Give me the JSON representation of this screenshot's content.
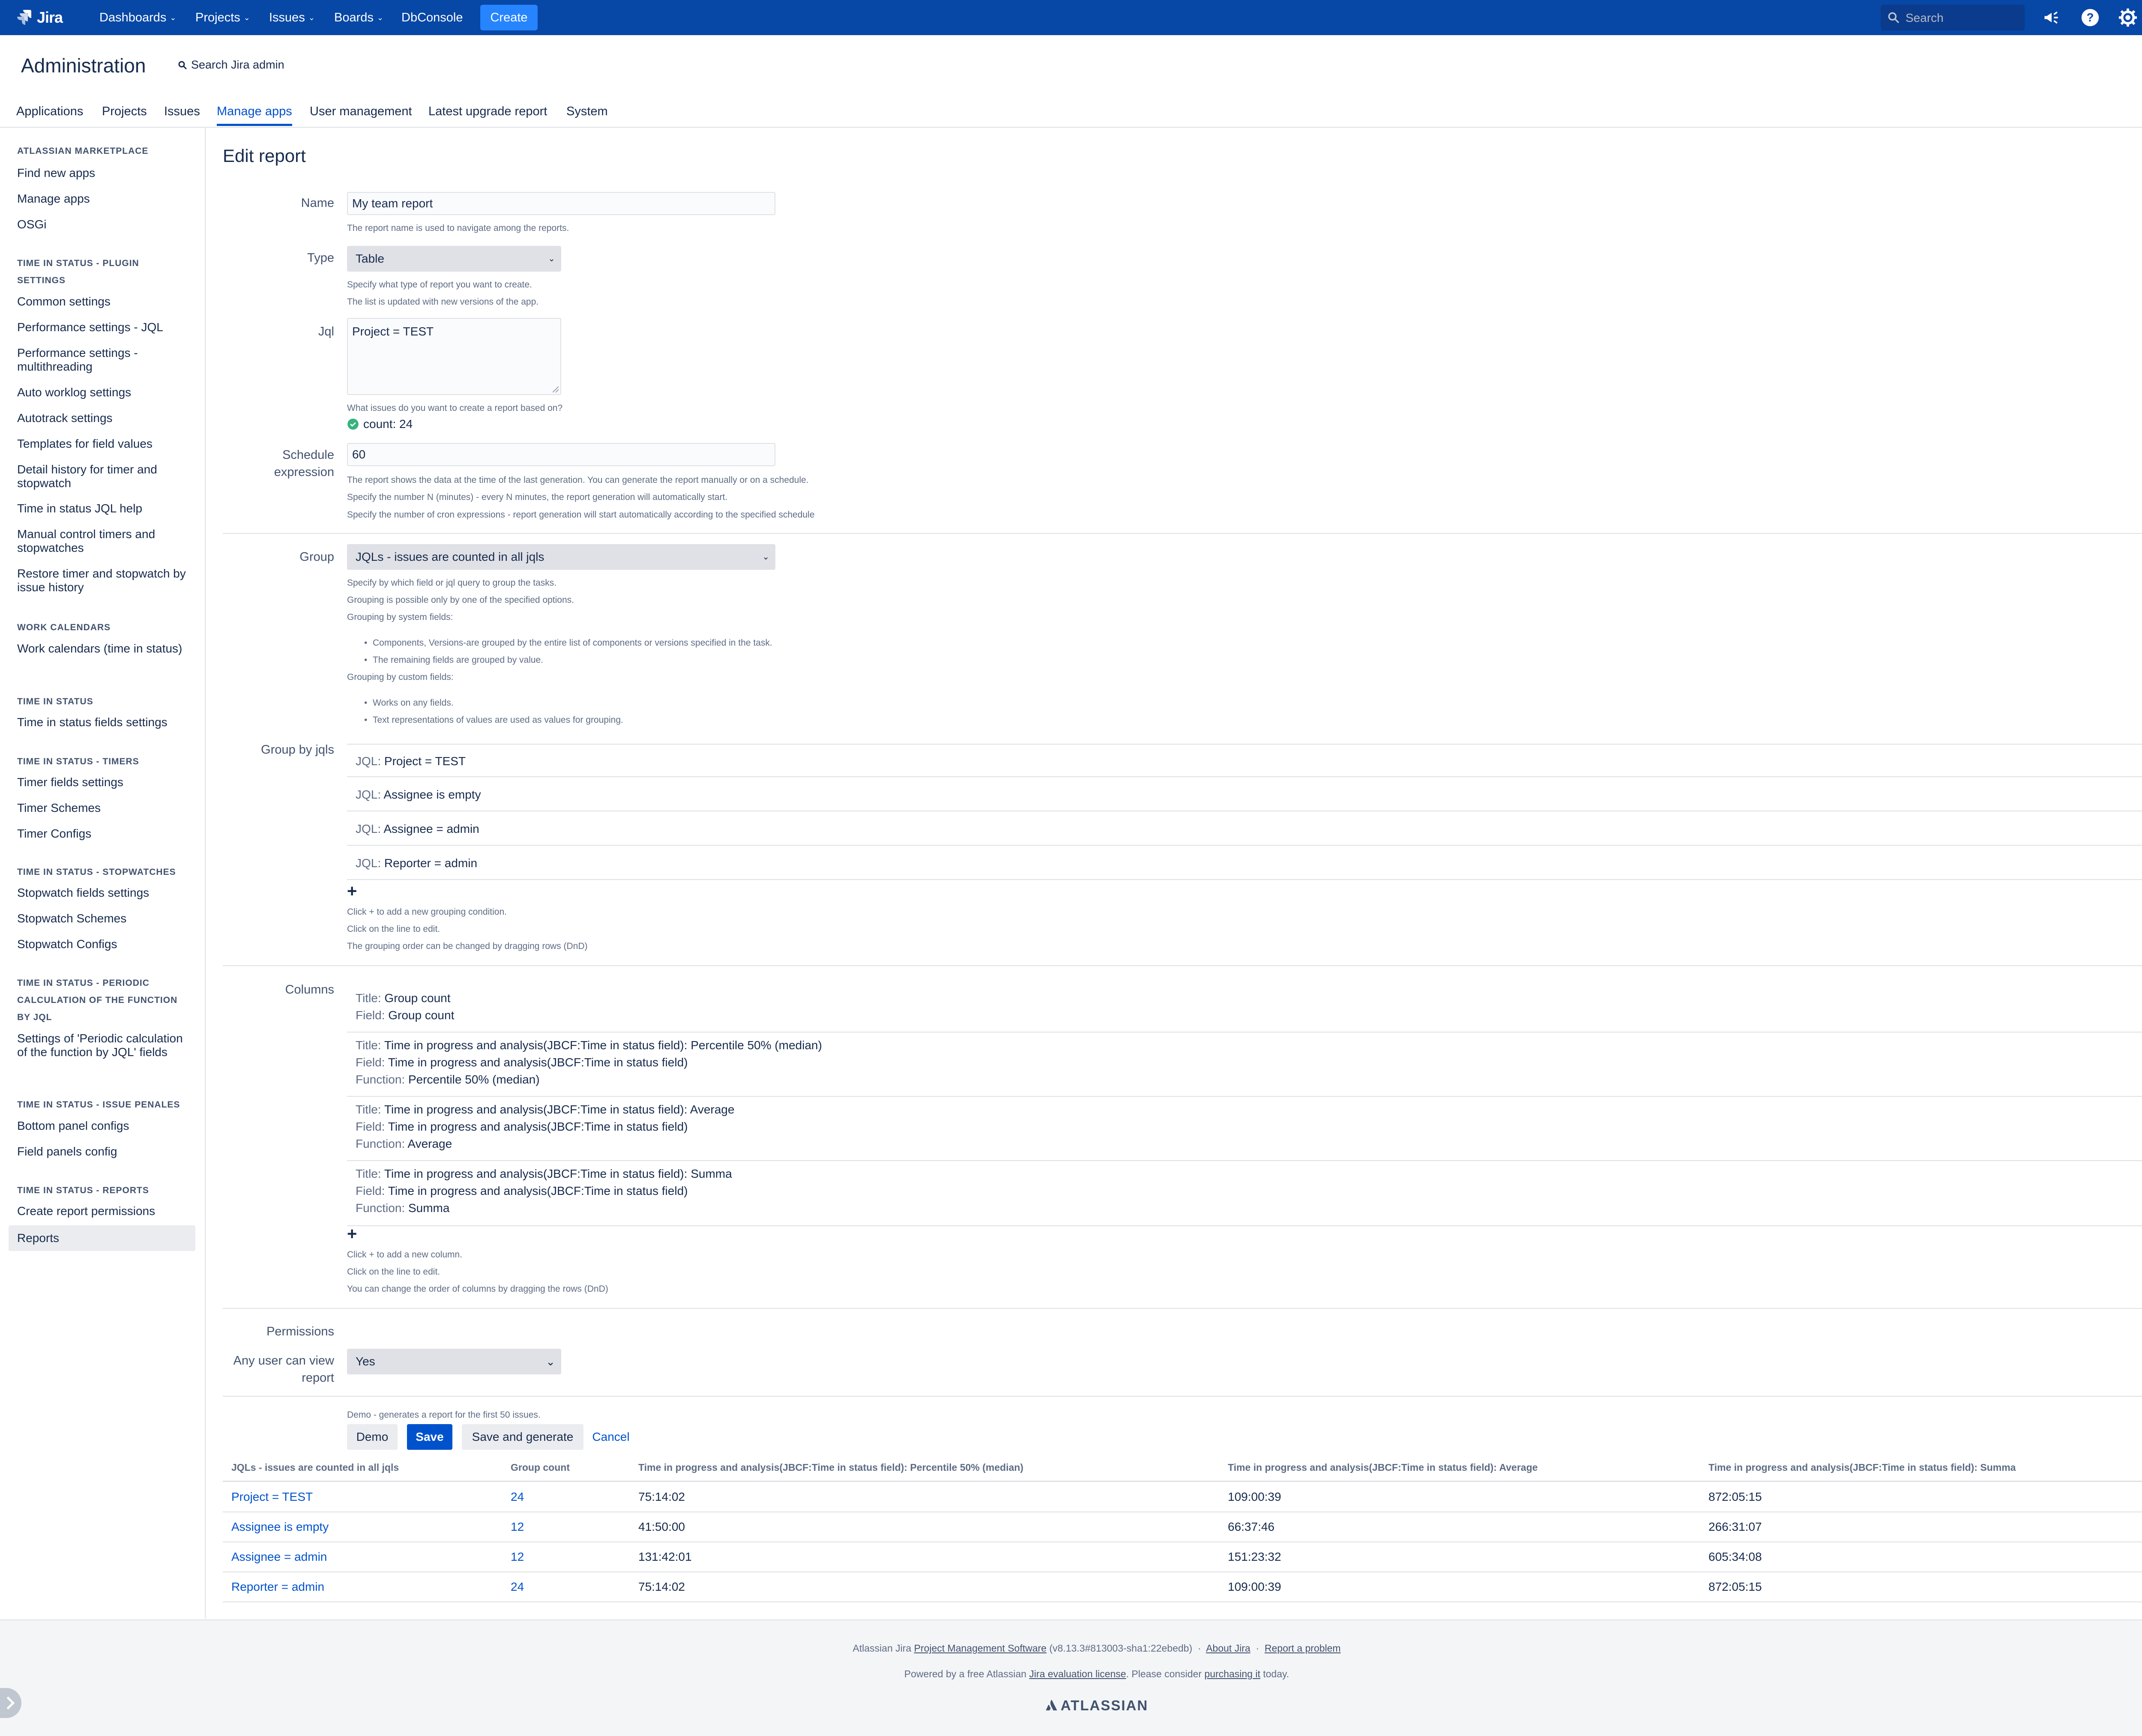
{
  "topnav": {
    "logo_text": "Jira",
    "items": [
      "Dashboards",
      "Projects",
      "Issues",
      "Boards",
      "DbConsole"
    ],
    "create_label": "Create",
    "search_placeholder": "Search"
  },
  "admin": {
    "title": "Administration",
    "search_label": "Search Jira admin",
    "tabs": [
      "Applications",
      "Projects",
      "Issues",
      "Manage apps",
      "User management",
      "Latest upgrade report",
      "System"
    ],
    "active_tab": "Manage apps"
  },
  "sidebar": {
    "sections": [
      {
        "heading": "ATLASSIAN MARKETPLACE",
        "items": [
          "Find new apps",
          "Manage apps",
          "OSGi"
        ]
      },
      {
        "heading": "TIME IN STATUS - PLUGIN SETTINGS",
        "items": [
          "Common settings",
          "Performance settings - JQL",
          "Performance settings - multithreading",
          "Auto worklog settings",
          "Autotrack settings",
          "Templates for field values",
          "Detail history for timer and stopwatch",
          "Time in status JQL help",
          "Manual control timers and stopwatches",
          "Restore timer and stopwatch by issue history"
        ]
      },
      {
        "heading": "WORK CALENDARS",
        "items": [
          "Work calendars (time in status)"
        ]
      },
      {
        "heading": "TIME IN STATUS",
        "items": [
          "Time in status fields settings"
        ]
      },
      {
        "heading": "TIME IN STATUS - TIMERS",
        "items": [
          "Timer fields settings",
          "Timer Schemes",
          "Timer Configs"
        ]
      },
      {
        "heading": "TIME IN STATUS - STOPWATCHES",
        "items": [
          "Stopwatch fields settings",
          "Stopwatch Schemes",
          "Stopwatch Configs"
        ]
      },
      {
        "heading": "TIME IN STATUS - PERIODIC CALCULATION OF THE FUNCTION BY JQL",
        "items": [
          "Settings of 'Periodic calculation of the function by JQL' fields"
        ]
      },
      {
        "heading": "TIME IN STATUS - ISSUE PENALES",
        "items": [
          "Bottom panel configs",
          "Field panels config"
        ]
      },
      {
        "heading": "TIME IN STATUS - REPORTS",
        "items": [
          "Create report permissions",
          "Reports"
        ]
      }
    ],
    "active_item": "Reports"
  },
  "form": {
    "page_title": "Edit report",
    "name": {
      "label": "Name",
      "value": "My team report",
      "hint": "The report name is used to navigate among the reports."
    },
    "type": {
      "label": "Type",
      "value": "Table",
      "hints": [
        "Specify what type of report you want to create.",
        "The list is updated with new versions of the app."
      ]
    },
    "jql": {
      "label": "Jql",
      "value": "Project = TEST",
      "hint": "What issues do you want to create a report based on?",
      "count_text": "count: 24"
    },
    "schedule": {
      "label_line1": "Schedule",
      "label_line2": "expression",
      "value": "60",
      "hints": [
        "The report shows the data at the time of the last generation. You can generate the report manually or on a schedule.",
        "Specify the number N (minutes) - every N minutes, the report generation will automatically start.",
        "Specify the number of cron expressions - report generation will start automatically according to the specified schedule"
      ]
    },
    "group": {
      "label": "Group",
      "value": "JQLs - issues are counted in all jqls",
      "hints": [
        "Specify by which field or jql query to group the tasks.",
        "Grouping is possible only by one of the specified options.",
        "Grouping by system fields:"
      ],
      "system_bullets": [
        "Components, Versions-are grouped by the entire list of components or versions specified in the task.",
        "The remaining fields are grouped by value."
      ],
      "custom_hint": "Grouping by custom fields:",
      "custom_bullets": [
        "Works on any fields.",
        "Text representations of values are used as values for grouping."
      ]
    },
    "group_by_jqls": {
      "label": "Group by jqls",
      "key": "JQL:",
      "rows": [
        "Project = TEST",
        "Assignee is empty",
        "Assignee = admin",
        "Reporter = admin"
      ],
      "hints": [
        "Click + to add a new grouping condition.",
        "Click on the line to edit.",
        "The grouping order can be changed by dragging rows (DnD)"
      ]
    },
    "columns": {
      "label": "Columns",
      "keys": {
        "title": "Title:",
        "field": "Field:",
        "function": "Function:"
      },
      "items": [
        {
          "title": "Group count",
          "field": "Group count"
        },
        {
          "title": "Time in progress and analysis(JBCF:Time in status field): Percentile 50% (median)",
          "field": "Time in progress and analysis(JBCF:Time in status field)",
          "function": "Percentile 50% (median)"
        },
        {
          "title": "Time in progress and analysis(JBCF:Time in status field): Average",
          "field": "Time in progress and analysis(JBCF:Time in status field)",
          "function": "Average"
        },
        {
          "title": "Time in progress and analysis(JBCF:Time in status field): Summa",
          "field": "Time in progress and analysis(JBCF:Time in status field)",
          "function": "Summa"
        }
      ],
      "hints": [
        "Click + to add a new column.",
        "Click on the line to edit.",
        "You can change the order of columns by dragging the rows (DnD)"
      ]
    },
    "permissions": {
      "label": "Permissions",
      "view_label_line1": "Any user can view",
      "view_label_line2": "report",
      "value": "Yes"
    },
    "actions": {
      "hint": "Demo - generates a report for the first 50 issues.",
      "demo": "Demo",
      "save": "Save",
      "save_generate": "Save and generate",
      "cancel": "Cancel"
    }
  },
  "results": {
    "headers": [
      "JQLs - issues are counted in all jqls",
      "Group count",
      "Time in progress and analysis(JBCF:Time in status field): Percentile 50% (median)",
      "Time in progress and analysis(JBCF:Time in status field): Average",
      "Time in progress and analysis(JBCF:Time in status field): Summa"
    ],
    "rows": [
      [
        "Project = TEST",
        "24",
        "75:14:02",
        "109:00:39",
        "872:05:15"
      ],
      [
        "Assignee is empty",
        "12",
        "41:50:00",
        "66:37:46",
        "266:31:07"
      ],
      [
        "Assignee = admin",
        "12",
        "131:42:01",
        "151:23:32",
        "605:34:08"
      ],
      [
        "Reporter = admin",
        "24",
        "75:14:02",
        "109:00:39",
        "872:05:15"
      ]
    ]
  },
  "footer": {
    "line1_prefix": "Atlassian Jira",
    "line1_link": "Project Management Software",
    "line1_version": "(v8.13.3#813003-sha1:22ebedb)",
    "about": "About Jira",
    "report": "Report a problem",
    "line2_prefix": "Powered by a free Atlassian",
    "line2_link": "Jira evaluation license",
    "line2_mid": ". Please consider",
    "line2_link2": "purchasing it",
    "line2_suffix": "today.",
    "brand": "ATLASSIAN"
  },
  "colors": {
    "nav_bg": "#0747a6",
    "primary": "#0052cc",
    "create": "#2684ff",
    "success": "#36b37e",
    "feedback_badge": "#ffab00"
  }
}
